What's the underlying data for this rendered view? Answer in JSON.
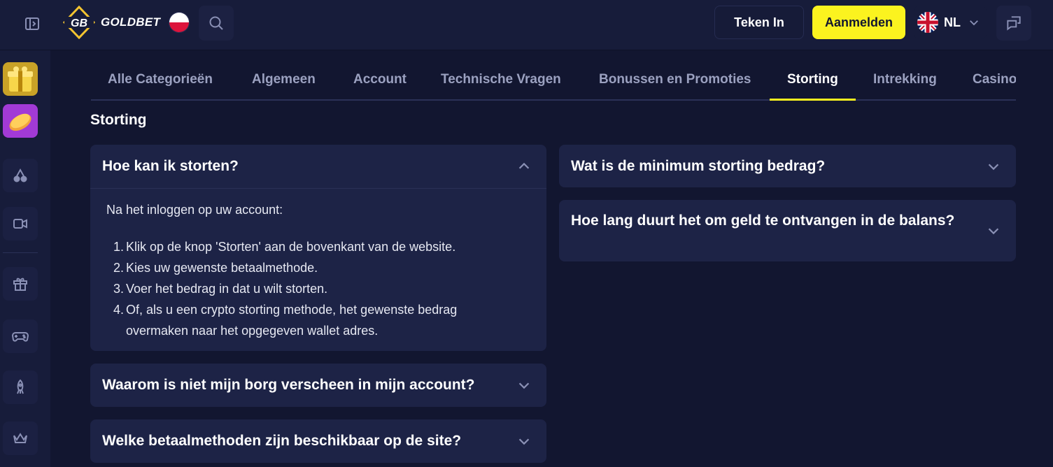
{
  "header": {
    "logo_text": "GOLDBET",
    "signin_label": "Teken In",
    "register_label": "Aanmelden",
    "language_code": "NL"
  },
  "colors": {
    "accent": "#fbf31f",
    "background": "#121630",
    "card": "#1d2346"
  },
  "icons": {
    "sidebar_toggle": "sidebar-toggle-icon",
    "search": "search-icon",
    "chat": "chat-icon",
    "sidebar": [
      "gift-box-image",
      "coin-image",
      "cherry-icon",
      "video-camera-icon",
      "gift-icon",
      "gamepad-icon",
      "rocket-icon",
      "crown-icon"
    ]
  },
  "tabs": [
    {
      "label": "Alle Categorieën",
      "active": false
    },
    {
      "label": "Algemeen",
      "active": false
    },
    {
      "label": "Account",
      "active": false
    },
    {
      "label": "Technische Vragen",
      "active": false
    },
    {
      "label": "Bonussen en Promoties",
      "active": false
    },
    {
      "label": "Storting",
      "active": true
    },
    {
      "label": "Intrekking",
      "active": false
    },
    {
      "label": "Casino",
      "active": false
    }
  ],
  "section_title": "Storting",
  "faqs": [
    {
      "question": "Hoe kan ik storten?",
      "expanded": true,
      "answer_intro": "Na het inloggen op uw account:",
      "answer_steps": [
        "Klik op de knop 'Storten' aan de bovenkant van de website.",
        "Kies uw gewenste betaalmethode.",
        "Voer het bedrag in dat u wilt storten.",
        "Of, als u een crypto storting methode, het gewenste bedrag overmaken naar het opgegeven wallet adres."
      ]
    },
    {
      "question": "Wat is de minimum storting bedrag?",
      "expanded": false
    },
    {
      "question": "Hoe lang duurt het om geld te ontvangen in de balans?",
      "expanded": false
    },
    {
      "question": "Waarom is niet mijn borg verscheen in mijn account?",
      "expanded": false
    },
    {
      "question": "Welke betaalmethoden zijn beschikbaar op de site?",
      "expanded": false
    }
  ]
}
